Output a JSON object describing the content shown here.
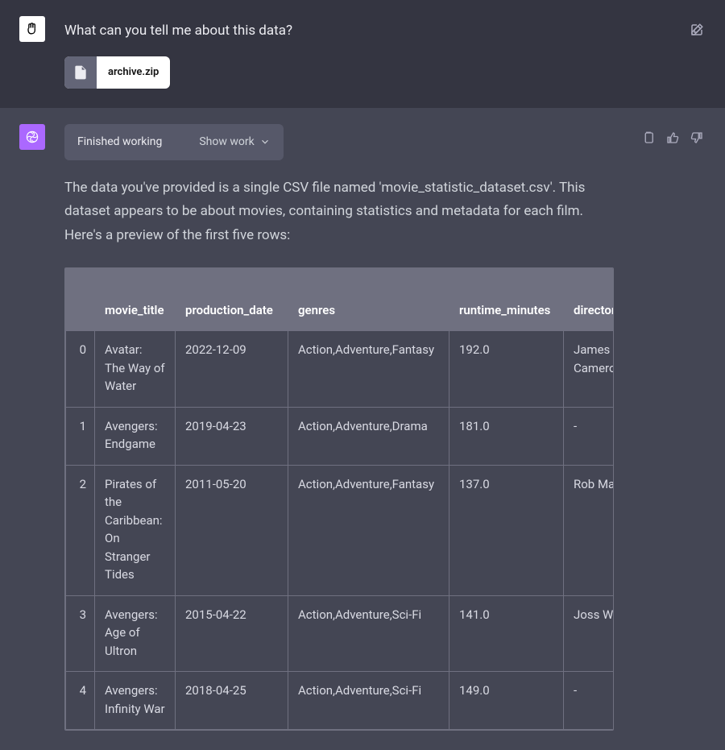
{
  "user": {
    "prompt": "What can you tell me about this data?",
    "attachment_name": "archive.zip"
  },
  "assistant": {
    "status_label": "Finished working",
    "show_work_label": "Show work",
    "response_text": "The data you've provided is a single CSV file named 'movie_statistic_dataset.csv'. This dataset appears to be about movies, containing statistics and metadata for each film. Here's a preview of the first five rows:"
  },
  "table": {
    "headers": [
      "",
      "movie_title",
      "production_date",
      "genres",
      "runtime_minutes",
      "director_name"
    ],
    "header_display": [
      "",
      "movie_title",
      "production_date",
      "genres",
      "runtime_minutes",
      "director_n"
    ],
    "rows": [
      {
        "idx": "0",
        "movie_title": "Avatar: The Way of Water",
        "production_date": "2022-12-09",
        "genres": "Action,Adventure,Fantasy",
        "runtime_minutes": "192.0",
        "director_name": "James Cameron"
      },
      {
        "idx": "1",
        "movie_title": "Avengers: Endgame",
        "production_date": "2019-04-23",
        "genres": "Action,Adventure,Drama",
        "runtime_minutes": "181.0",
        "director_name": "-"
      },
      {
        "idx": "2",
        "movie_title": "Pirates of the Caribbean: On Stranger Tides",
        "production_date": "2011-05-20",
        "genres": "Action,Adventure,Fantasy",
        "runtime_minutes": "137.0",
        "director_name": "Rob Marsh"
      },
      {
        "idx": "3",
        "movie_title": "Avengers: Age of Ultron",
        "production_date": "2015-04-22",
        "genres": "Action,Adventure,Sci-Fi",
        "runtime_minutes": "141.0",
        "director_name": "Joss Whed"
      },
      {
        "idx": "4",
        "movie_title": "Avengers: Infinity War",
        "production_date": "2018-04-25",
        "genres": "Action,Adventure,Sci-Fi",
        "runtime_minutes": "149.0",
        "director_name": "-"
      }
    ]
  }
}
